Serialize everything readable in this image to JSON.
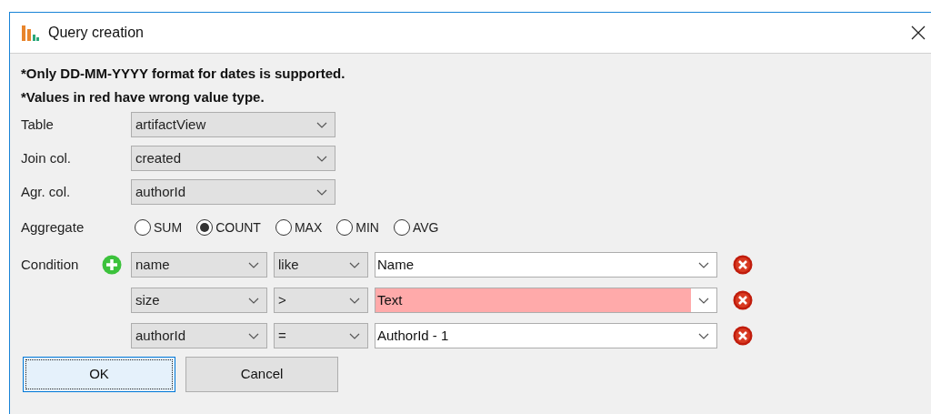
{
  "window": {
    "title": "Query creation"
  },
  "notes": [
    "*Only DD-MM-YYYY format for dates is supported.",
    "*Values in red have wrong value type."
  ],
  "fields": [
    {
      "label": "Table",
      "value": "artifactView"
    },
    {
      "label": "Join col.",
      "value": "created"
    },
    {
      "label": "Agr. col.",
      "value": "authorId"
    }
  ],
  "aggregate": {
    "label": "Aggregate",
    "options": [
      {
        "label": "SUM",
        "selected": false
      },
      {
        "label": "COUNT",
        "selected": true
      },
      {
        "label": "MAX",
        "selected": false
      },
      {
        "label": "MIN",
        "selected": false
      },
      {
        "label": "AVG",
        "selected": false
      }
    ]
  },
  "conditions": {
    "label": "Condition",
    "rows": [
      {
        "column": "name",
        "operator": "like",
        "value": "Name",
        "invalid": false
      },
      {
        "column": "size",
        "operator": ">",
        "value": "Text",
        "invalid": true
      },
      {
        "column": "authorId",
        "operator": "=",
        "value": "AuthorId - 1",
        "invalid": false
      }
    ]
  },
  "buttons": [
    {
      "label": "OK",
      "focused": true
    },
    {
      "label": "Cancel",
      "focused": false
    }
  ]
}
